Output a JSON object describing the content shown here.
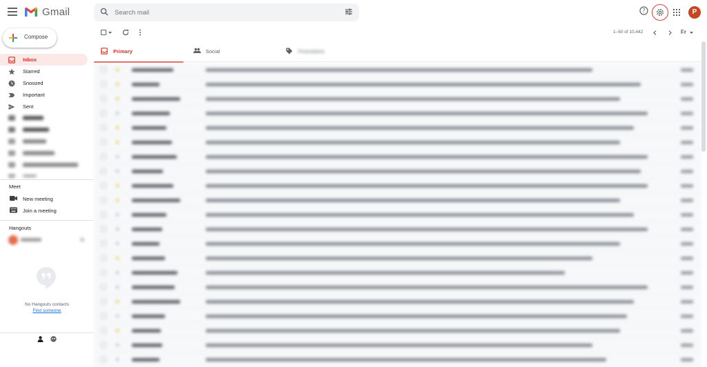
{
  "header": {
    "app_name": "Gmail",
    "search_placeholder": "Search mail",
    "avatar_initial": "P"
  },
  "compose_label": "Compose",
  "nav": [
    {
      "label": "Inbox",
      "icon": "inbox-icon",
      "active": true
    },
    {
      "label": "Starred",
      "icon": "star-icon"
    },
    {
      "label": "Snoozed",
      "icon": "clock-icon"
    },
    {
      "label": "Important",
      "icon": "important-icon"
    },
    {
      "label": "Sent",
      "icon": "send-icon"
    }
  ],
  "meet": {
    "title": "Meet",
    "new_meeting": "New meeting",
    "join_meeting": "Join a meeting"
  },
  "hangouts": {
    "title": "Hangouts",
    "empty_text": "No Hangouts contacts",
    "find_link": "Find someone"
  },
  "toolbar": {
    "pager": "1–50 of 10,442",
    "lang": "Fr"
  },
  "tabs": [
    {
      "label": "Primary",
      "icon": "inbox-icon",
      "active": true
    },
    {
      "label": "Social",
      "icon": "people-icon"
    },
    {
      "label": "Promotions",
      "icon": "tag-icon"
    }
  ],
  "colors": {
    "accent_red": "#d93025",
    "active_bg": "#fce8e6",
    "star_yellow": "#f2c94c",
    "highlight_ring": "#e53935"
  }
}
